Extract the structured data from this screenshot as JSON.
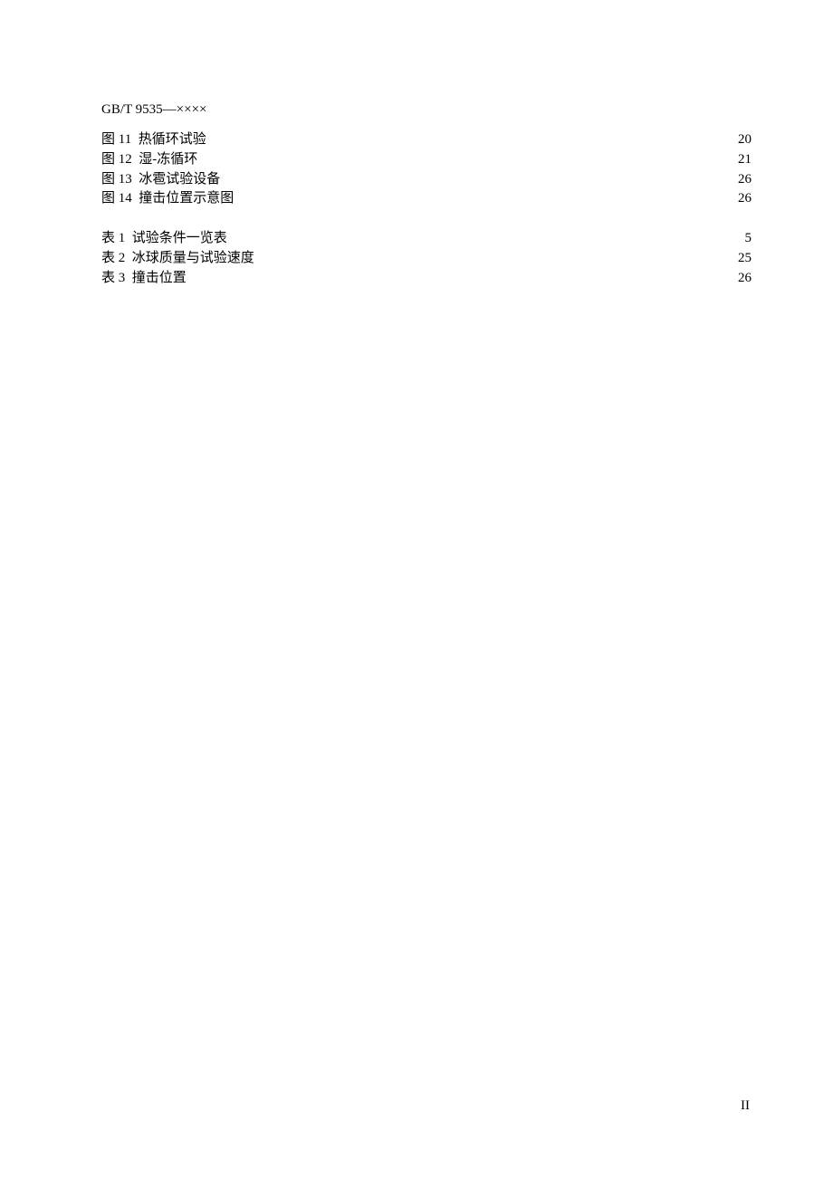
{
  "header": "GB/T 9535—××××",
  "figures": [
    {
      "prefix": "图 11",
      "title": "热循环试验",
      "page": "20"
    },
    {
      "prefix": "图 12",
      "title": "湿-冻循环",
      "page": "21"
    },
    {
      "prefix": "图 13",
      "title": "冰雹试验设备",
      "page": "26"
    },
    {
      "prefix": "图 14",
      "title": "撞击位置示意图",
      "page": "26"
    }
  ],
  "tables": [
    {
      "prefix": "表 1",
      "title": "试验条件一览表",
      "page": "5"
    },
    {
      "prefix": "表 2",
      "title": "冰球质量与试验速度",
      "page": "25"
    },
    {
      "prefix": "表 3",
      "title": "撞击位置",
      "page": "26"
    }
  ],
  "page_number": "II"
}
